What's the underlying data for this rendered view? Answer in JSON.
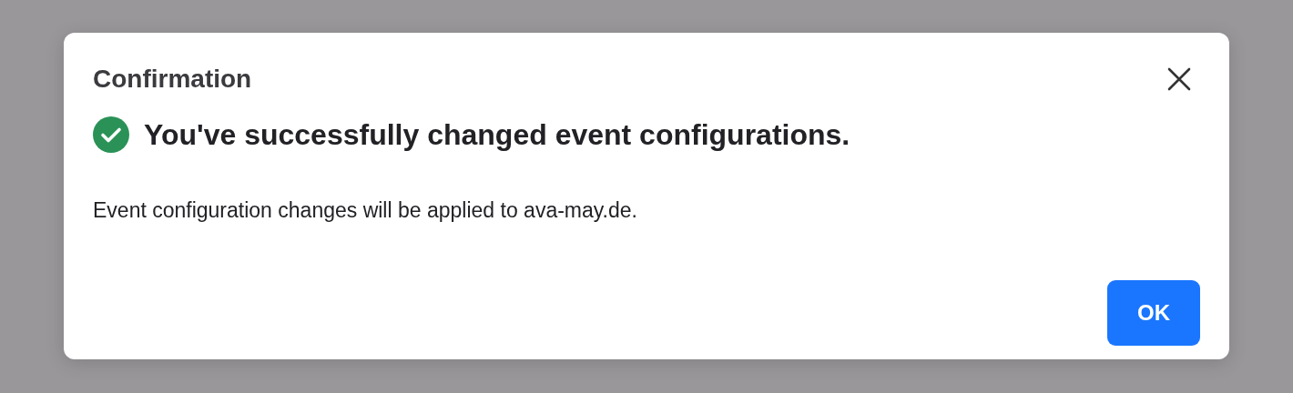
{
  "dialog": {
    "title": "Confirmation",
    "message": {
      "kind": "success",
      "text": "You've successfully changed event configurations."
    },
    "body": "Event configuration changes will be applied to ava-may.de.",
    "buttons": [
      {
        "label": "OK",
        "kind": "primary"
      }
    ]
  }
}
